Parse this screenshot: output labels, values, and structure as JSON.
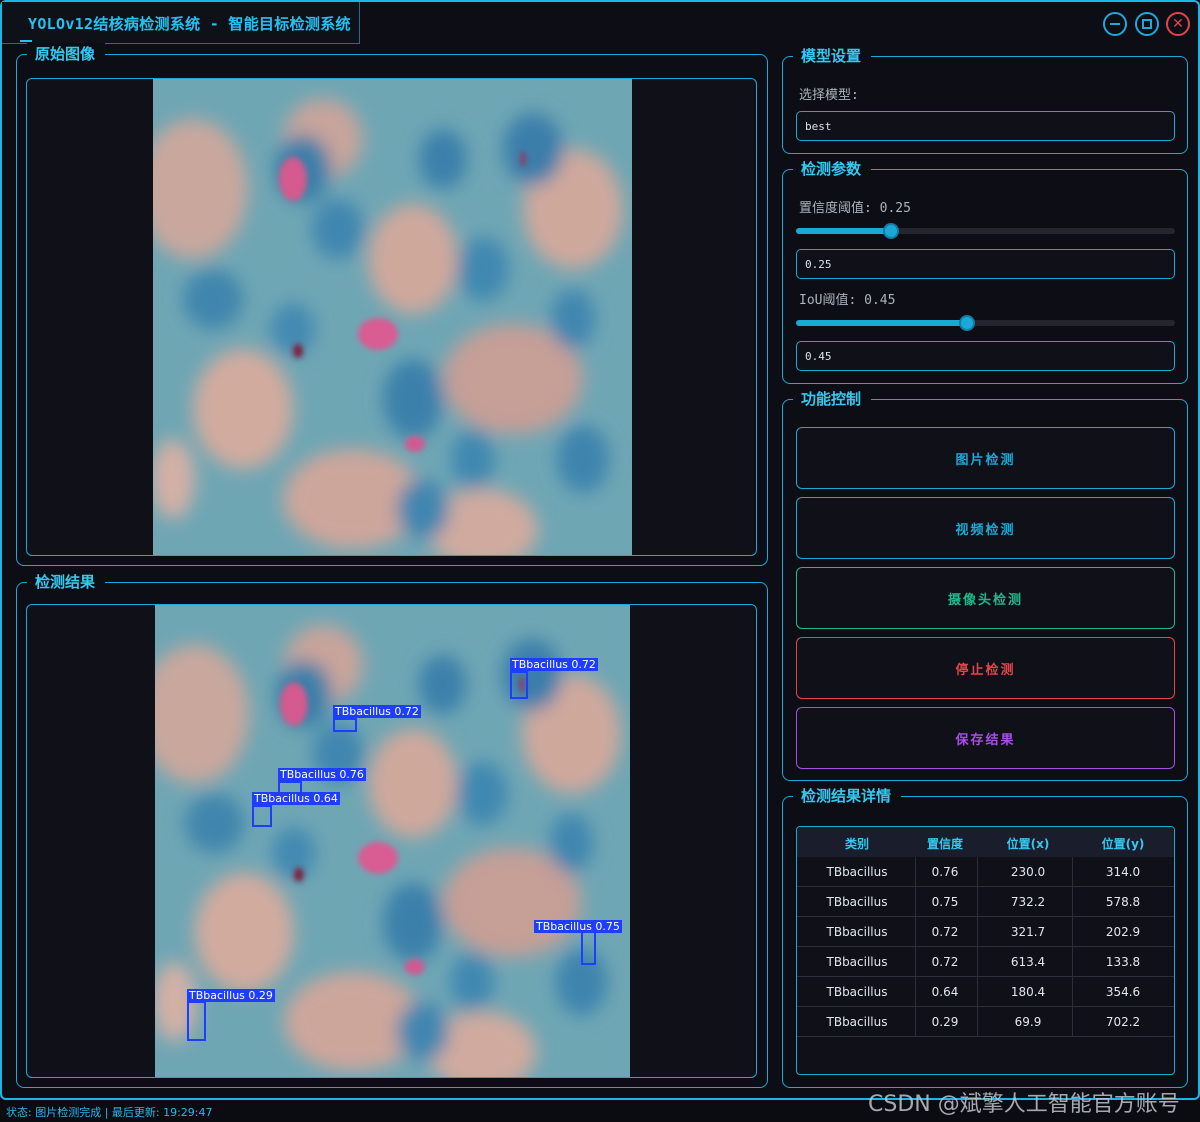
{
  "window": {
    "title": "YOLOv12结核病检测系统 - 智能目标检测系统"
  },
  "panels": {
    "original_title": "原始图像",
    "result_title": "检测结果",
    "model_title": "模型设置",
    "params_title": "检测参数",
    "control_title": "功能控制",
    "details_title": "检测结果详情"
  },
  "model": {
    "select_label": "选择模型:",
    "selected": "best"
  },
  "params": {
    "conf_label": "置信度阈值: 0.25",
    "conf_value": "0.25",
    "conf_level": 0.25,
    "iou_label": "IoU阈值: 0.45",
    "iou_value": "0.45",
    "iou_level": 0.45
  },
  "controls": {
    "image_detect": "图片检测",
    "video_detect": "视频检测",
    "camera_detect": "摄像头检测",
    "stop_detect": "停止检测",
    "save_result": "保存结果"
  },
  "colors": {
    "accent": "#1aa9d6",
    "camera_button": "#1fb98a",
    "stop_button": "#e0454b",
    "save_button": "#a64ee6",
    "detection_box": "#1f3dff"
  },
  "detections_overlay": [
    "TBbacillus 0.72",
    "TBbacillus 0.72",
    "TBbacillus 0.76",
    "TBbacillus 0.64",
    "TBbacillus 0.75",
    "TBbacillus 0.29"
  ],
  "table": {
    "headers": [
      "类别",
      "置信度",
      "位置(x)",
      "位置(y)"
    ],
    "rows": [
      [
        "TBbacillus",
        "0.76",
        "230.0",
        "314.0"
      ],
      [
        "TBbacillus",
        "0.75",
        "732.2",
        "578.8"
      ],
      [
        "TBbacillus",
        "0.72",
        "321.7",
        "202.9"
      ],
      [
        "TBbacillus",
        "0.72",
        "613.4",
        "133.8"
      ],
      [
        "TBbacillus",
        "0.64",
        "180.4",
        "354.6"
      ],
      [
        "TBbacillus",
        "0.29",
        "69.9",
        "702.2"
      ]
    ]
  },
  "status": {
    "text": "状态: 图片检测完成 | 最后更新: 19:29:47"
  },
  "watermark": "CSDN @斌擎人工智能官方账号"
}
